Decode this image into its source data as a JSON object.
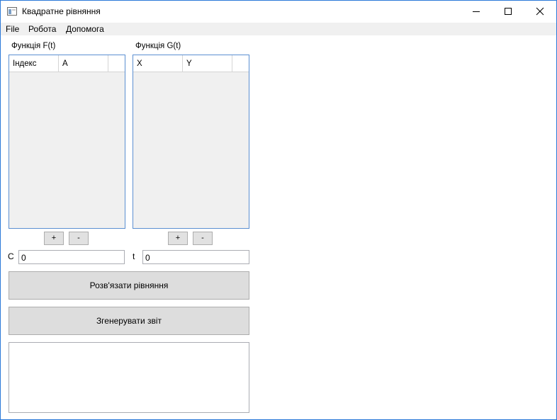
{
  "window": {
    "title": "Квадратне рівняння"
  },
  "menu": [
    "File",
    "Робота",
    "Допомога"
  ],
  "grid_f": {
    "label": "Функція F(t)",
    "columns": [
      "Індекс",
      "A"
    ],
    "add_label": "+",
    "remove_label": "-"
  },
  "grid_g": {
    "label": "Функція G(t)",
    "columns": [
      "X",
      "Y"
    ],
    "add_label": "+",
    "remove_label": "-"
  },
  "inputs": {
    "c": {
      "label": "C",
      "value": "0"
    },
    "t": {
      "label": "t",
      "value": "0"
    }
  },
  "buttons": {
    "solve": "Розв'язати рівняння",
    "report": "Згенерувати звіт"
  },
  "output": {
    "text": ""
  },
  "colors": {
    "accent_border": "#2b79d8",
    "grid_border": "#5b8fd1",
    "button_bg": "#dddddd"
  },
  "icons": [
    "app-icon",
    "minimize-icon",
    "maximize-icon",
    "close-icon"
  ]
}
